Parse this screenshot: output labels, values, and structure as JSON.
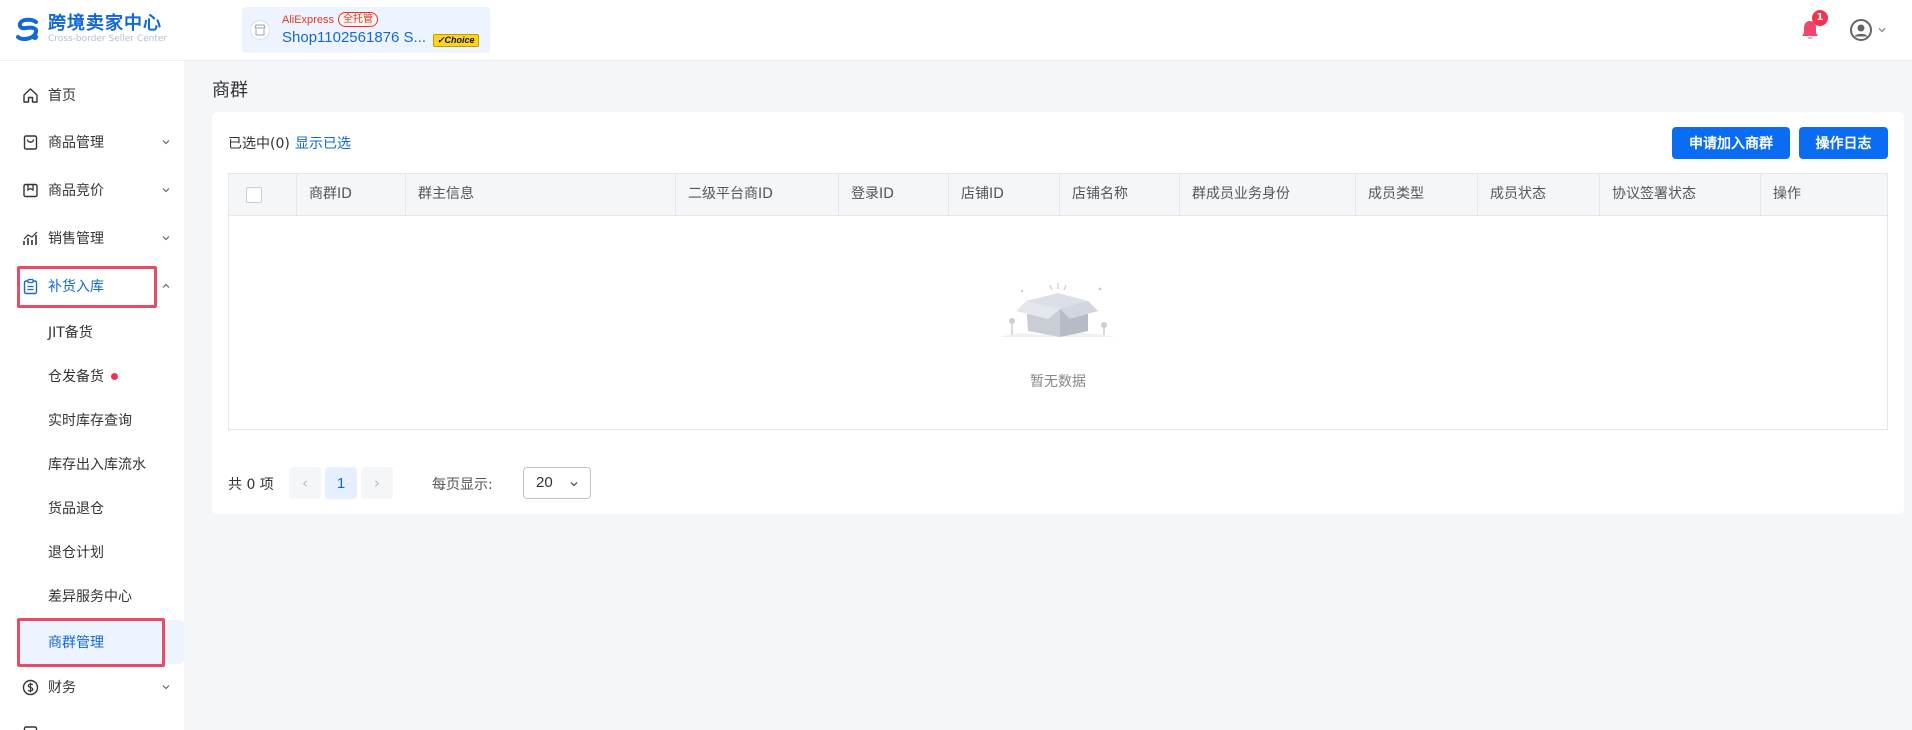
{
  "header": {
    "app_title": "跨境卖家中心",
    "app_subtitle": "Cross-border Seller Center",
    "brand": "AliExpress",
    "tag": "全托管",
    "shop_name": "Shop1102561876 S...",
    "choice_badge": "Choice",
    "notification_count": "1"
  },
  "sidebar": {
    "items": [
      {
        "label": "首页"
      },
      {
        "label": "商品管理"
      },
      {
        "label": "商品竞价"
      },
      {
        "label": "销售管理"
      },
      {
        "label": "补货入库"
      },
      {
        "label": "财务"
      }
    ],
    "subitems": [
      {
        "label": "JIT备货"
      },
      {
        "label": "仓发备货"
      },
      {
        "label": "实时库存查询"
      },
      {
        "label": "库存出入库流水"
      },
      {
        "label": "货品退仓"
      },
      {
        "label": "退仓计划"
      },
      {
        "label": "差异服务中心"
      },
      {
        "label": "商群管理"
      }
    ]
  },
  "main": {
    "page_title": "商群",
    "selected_info": "已选中(0)",
    "show_selected": "显示已选",
    "join_button": "申请加入商群",
    "log_button": "操作日志",
    "columns": [
      "商群ID",
      "群主信息",
      "二级平台商ID",
      "登录ID",
      "店铺ID",
      "店铺名称",
      "群成员业务身份",
      "成员类型",
      "成员状态",
      "协议签署状态",
      "操作"
    ],
    "empty_text": "暂无数据",
    "pagination": {
      "total": "共 0 项",
      "prev": "‹",
      "current": "1",
      "next": "›",
      "per_page_label": "每页显示:",
      "per_page_value": "20"
    }
  },
  "colors": {
    "accent": "#0a6cf3",
    "link": "#1268d8",
    "highlight": "#e94a66",
    "badge": "#f0334e"
  }
}
